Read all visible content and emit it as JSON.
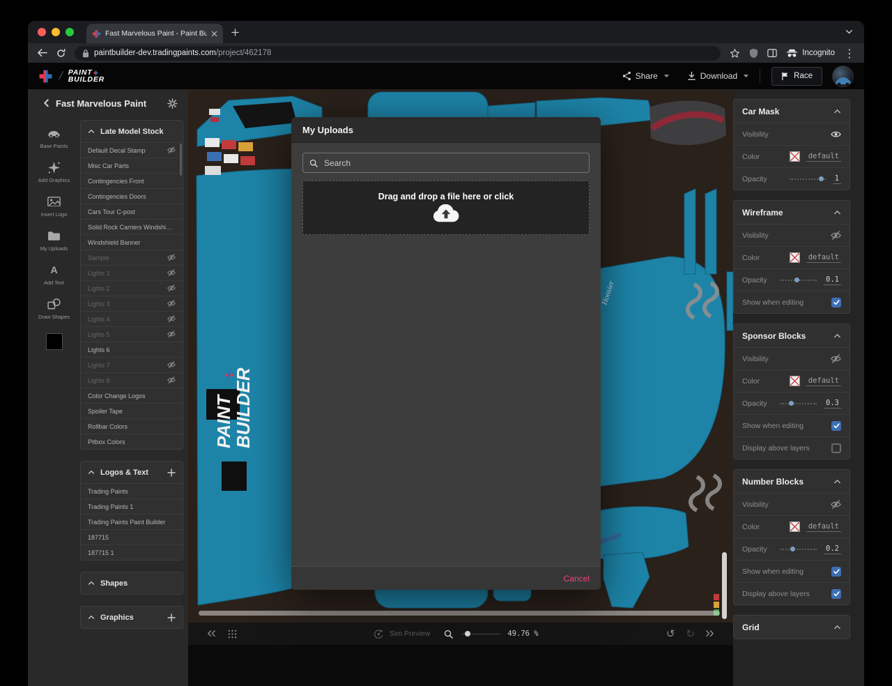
{
  "browser": {
    "tab_title": "Fast Marvelous Paint - Paint Bu",
    "url_host": "paintbuilder-dev.tradingpaints.com",
    "url_path": "/project/462178",
    "incognito_label": "Incognito"
  },
  "app_header": {
    "logo_line1": "PAINT",
    "logo_line2": "BUILDER",
    "logo_separator": "/",
    "share_label": "Share",
    "download_label": "Download",
    "race_label": "Race"
  },
  "sidebar": {
    "back_label": "Fast Marvelous Paint",
    "swatch_color": "#000000",
    "tools": [
      {
        "id": "base-paints",
        "label": "Base Paints",
        "icon": "car"
      },
      {
        "id": "add-graphics",
        "label": "Add Graphics",
        "icon": "spray"
      },
      {
        "id": "insert-logo",
        "label": "Insert Logo",
        "icon": "image"
      },
      {
        "id": "my-uploads",
        "label": "My Uploads",
        "icon": "folder"
      },
      {
        "id": "add-text",
        "label": "Add Text",
        "icon": "text"
      },
      {
        "id": "draw-shapes",
        "label": "Draw Shapes",
        "icon": "shapes"
      }
    ],
    "sections": [
      {
        "title": "Late Model Stock",
        "add": false,
        "layers": [
          {
            "name": "Default Decal Stamp",
            "hidden": true,
            "dim": false
          },
          {
            "name": "Misc Car Parts",
            "hidden": false,
            "dim": false
          },
          {
            "name": "Contingencies Front",
            "hidden": false,
            "dim": false
          },
          {
            "name": "Contingencies Doors",
            "hidden": false,
            "dim": false
          },
          {
            "name": "Cars Tour C-post",
            "hidden": false,
            "dim": false
          },
          {
            "name": "Solid Rock Carriers Windshiel...",
            "hidden": false,
            "dim": false
          },
          {
            "name": "Windshield Banner",
            "hidden": false,
            "dim": false
          },
          {
            "name": "Sample",
            "hidden": true,
            "dim": true
          },
          {
            "name": "Lights 1",
            "hidden": true,
            "dim": true
          },
          {
            "name": "Lights 2",
            "hidden": true,
            "dim": true
          },
          {
            "name": "Lights 3",
            "hidden": true,
            "dim": true
          },
          {
            "name": "Lights 4",
            "hidden": true,
            "dim": true
          },
          {
            "name": "Lights 5",
            "hidden": true,
            "dim": true
          },
          {
            "name": "Lights 6",
            "hidden": false,
            "dim": false
          },
          {
            "name": "Lights 7",
            "hidden": true,
            "dim": true
          },
          {
            "name": "Lights 8",
            "hidden": true,
            "dim": true
          },
          {
            "name": "Color Change Logos",
            "hidden": false,
            "dim": false
          },
          {
            "name": "Spoiler Tape",
            "hidden": false,
            "dim": false
          },
          {
            "name": "Rollbar Colors",
            "hidden": false,
            "dim": false
          },
          {
            "name": "Pitbox Colors",
            "hidden": false,
            "dim": false
          }
        ]
      },
      {
        "title": "Logos & Text",
        "add": true,
        "layers": [
          {
            "name": "Trading Paints",
            "hidden": false,
            "dim": false
          },
          {
            "name": "Trading Paints 1",
            "hidden": false,
            "dim": false
          },
          {
            "name": "Trading Paints Paint Builder",
            "hidden": false,
            "dim": false
          },
          {
            "name": "187715",
            "hidden": false,
            "dim": false
          },
          {
            "name": "187715 1",
            "hidden": false,
            "dim": false
          }
        ]
      },
      {
        "title": "Shapes",
        "add": false,
        "layers": []
      },
      {
        "title": "Graphics",
        "add": true,
        "layers": []
      }
    ]
  },
  "modal": {
    "title": "My Uploads",
    "search_placeholder": "Search",
    "dropzone_label": "Drag and drop a file here or click",
    "cancel_label": "Cancel"
  },
  "canvas_bar": {
    "sim_preview_label": "Sim Preview",
    "zoom_value": "49.76 %"
  },
  "canvas": {
    "door_logo_line1": "PAINT",
    "door_logo_line2": "BUILDER",
    "decal_text_1": "Hoosier",
    "decal_text_2": "Hoosier"
  },
  "panels": [
    {
      "title": "Car Mask",
      "rows": [
        {
          "type": "eye",
          "label": "Visibility",
          "visible": true
        },
        {
          "type": "color",
          "label": "Color",
          "value": "default"
        },
        {
          "type": "slider",
          "label": "Opacity",
          "value": "1",
          "pos": 0.88
        }
      ]
    },
    {
      "title": "Wireframe",
      "rows": [
        {
          "type": "eye",
          "label": "Visibility",
          "visible": false
        },
        {
          "type": "color",
          "label": "Color",
          "value": "default"
        },
        {
          "type": "slider",
          "label": "Opacity",
          "value": "0.1",
          "pos": 0.45
        },
        {
          "type": "checkbox",
          "label": "Show when editing",
          "checked": true
        }
      ]
    },
    {
      "title": "Sponsor Blocks",
      "rows": [
        {
          "type": "eye",
          "label": "Visibility",
          "visible": false
        },
        {
          "type": "color",
          "label": "Color",
          "value": "default"
        },
        {
          "type": "slider",
          "label": "Opacity",
          "value": "0.3",
          "pos": 0.28
        },
        {
          "type": "checkbox",
          "label": "Show when editing",
          "checked": true
        },
        {
          "type": "checkbox",
          "label": "Display above layers",
          "checked": false
        }
      ]
    },
    {
      "title": "Number Blocks",
      "rows": [
        {
          "type": "eye",
          "label": "Visibility",
          "visible": false
        },
        {
          "type": "color",
          "label": "Color",
          "value": "default"
        },
        {
          "type": "slider",
          "label": "Opacity",
          "value": "0.2",
          "pos": 0.33
        },
        {
          "type": "checkbox",
          "label": "Show when editing",
          "checked": true
        },
        {
          "type": "checkbox",
          "label": "Display above layers",
          "checked": true
        }
      ]
    },
    {
      "title": "Grid",
      "rows": []
    }
  ],
  "colors": {
    "accent_pink": "#f0467a",
    "teal": "#1d84a8",
    "canvas_bg": "#2a211b",
    "checkbox_blue": "#3d6fb4",
    "tp_red": "#e23b4f",
    "tp_blue": "#2e6fb7"
  }
}
